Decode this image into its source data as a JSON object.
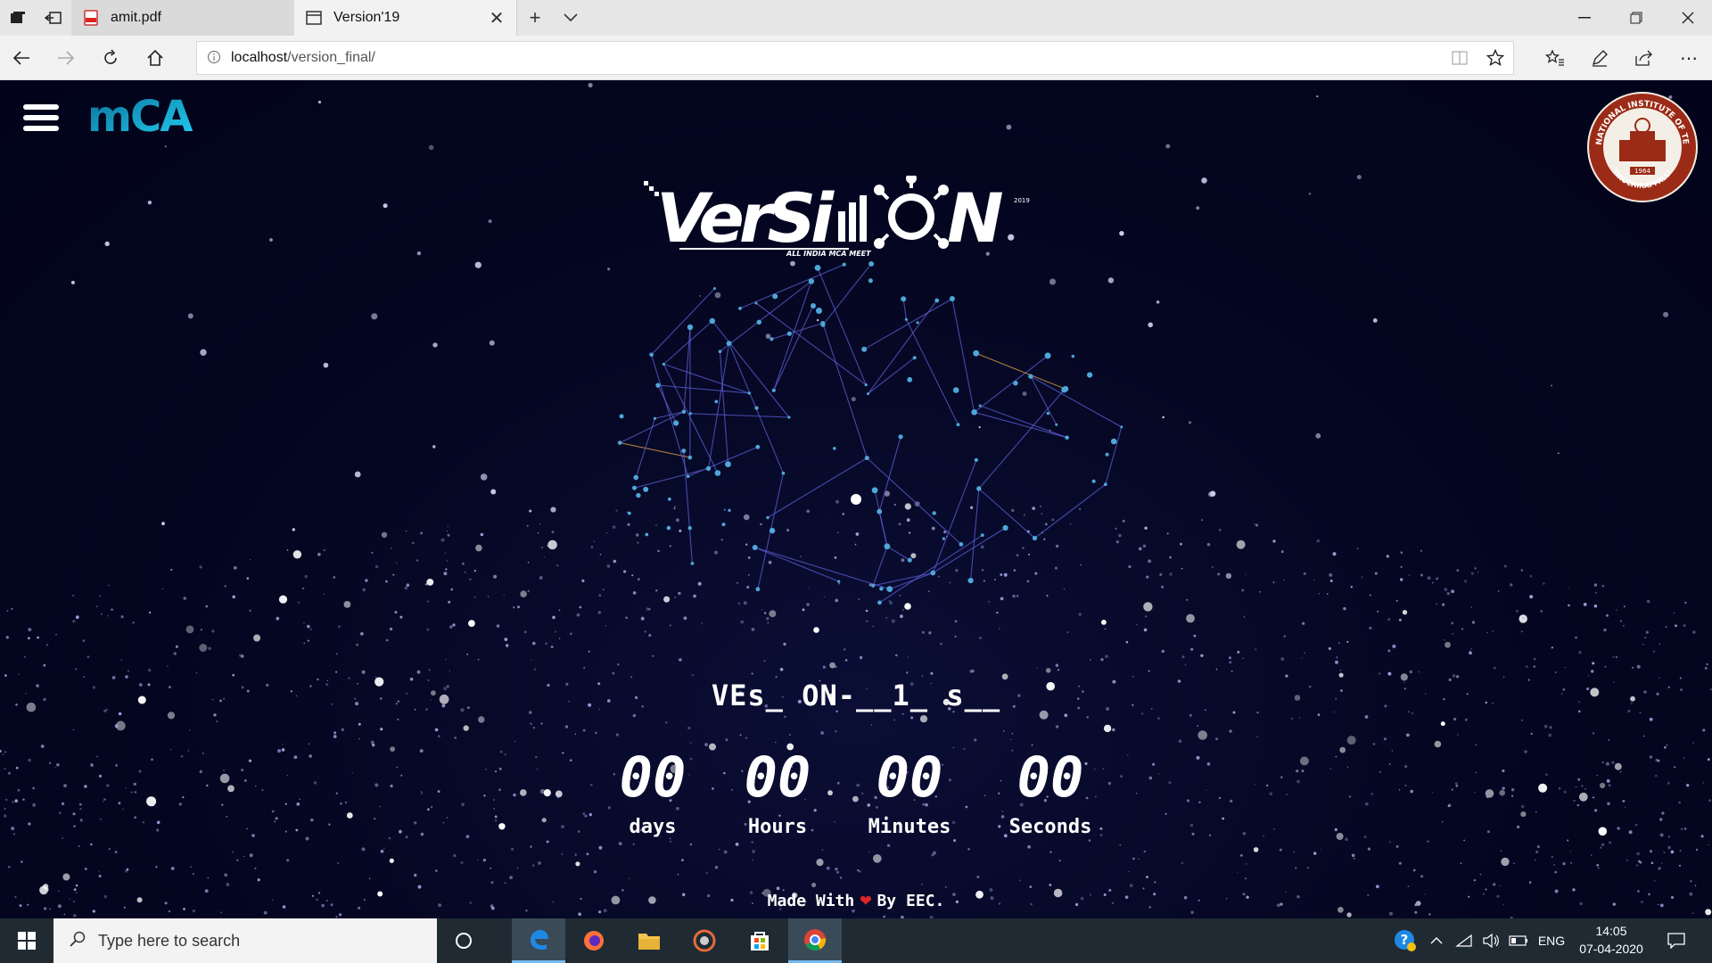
{
  "browser": {
    "tabs": [
      {
        "label": "amit.pdf",
        "icon": "pdf-icon",
        "active": false
      },
      {
        "label": "Version'19",
        "icon": "page-icon",
        "active": true
      }
    ],
    "url_host": "localhost",
    "url_path": "/version_final/"
  },
  "page": {
    "mca_logo": "mCA",
    "nit_logo_text": "NATIONAL INSTITUTE OF TECHNOLOGY",
    "nit_logo_bottom": "TIRUCHIRAPPALLI",
    "nit_logo_year": "1964",
    "version_logo": "VerSi    N",
    "version_logo_sub": "ALL INDIA MCA MEET",
    "version_logo_year": "2019",
    "glitch_text": "VEs_ ON-__1_ s__",
    "countdown": [
      {
        "value": "00",
        "label": "days"
      },
      {
        "value": "00",
        "label": "Hours"
      },
      {
        "value": "00",
        "label": "Minutes"
      },
      {
        "value": "00",
        "label": "Seconds"
      }
    ],
    "footer_before": "Made With",
    "footer_after": "By EEC."
  },
  "taskbar": {
    "search_placeholder": "Type here to search",
    "lang": "ENG",
    "time": "14:05",
    "date": "07-04-2020"
  },
  "colors": {
    "page_bg": "#03041c",
    "accent_cyan": "#1ab3d9",
    "heart": "#e02424",
    "network_line": "#5b5fd6"
  }
}
